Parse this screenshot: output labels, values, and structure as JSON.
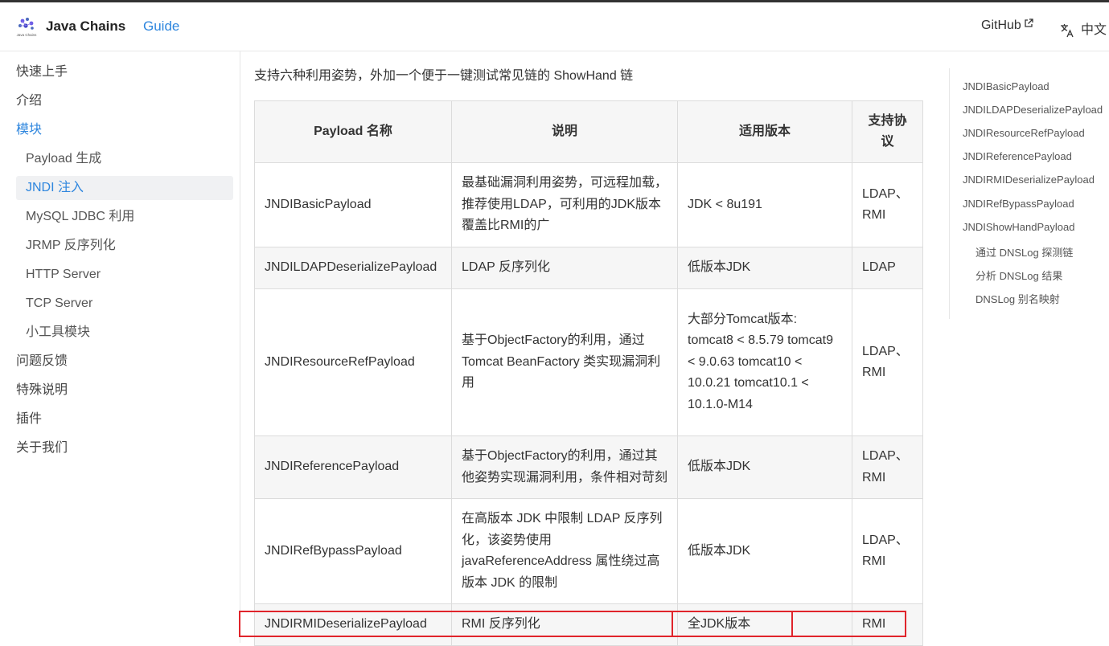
{
  "header": {
    "brand": "Java Chains",
    "nav_guide": "Guide",
    "github": "GitHub",
    "language": "中文",
    "logo_caption": "Java Chains"
  },
  "sidebar": {
    "items": [
      {
        "label": "快速上手"
      },
      {
        "label": "介绍"
      },
      {
        "label": "模块"
      },
      {
        "label": "Payload 生成"
      },
      {
        "label": "JNDI 注入"
      },
      {
        "label": "MySQL JDBC 利用"
      },
      {
        "label": "JRMP 反序列化"
      },
      {
        "label": "HTTP Server"
      },
      {
        "label": "TCP Server"
      },
      {
        "label": "小工具模块"
      },
      {
        "label": "问题反馈"
      },
      {
        "label": "特殊说明"
      },
      {
        "label": "插件"
      },
      {
        "label": "关于我们"
      }
    ]
  },
  "content": {
    "intro": "支持六种利用姿势，外加一个便于一键测试常见链的 ShowHand 链",
    "table": {
      "headers": [
        "Payload 名称",
        "说明",
        "适用版本",
        "支持协议"
      ],
      "rows": [
        {
          "name": "JNDIBasicPayload",
          "desc": "最基础漏洞利用姿势，可远程加载，推荐使用LDAP，可利用的JDK版本覆盖比RMI的广",
          "version": "JDK < 8u191",
          "protocol": "LDAP、RMI"
        },
        {
          "name": "JNDILDAPDeserializePayload",
          "desc": "LDAP 反序列化",
          "version": "低版本JDK",
          "protocol": "LDAP"
        },
        {
          "name": "JNDIResourceRefPayload",
          "desc": "基于ObjectFactory的利用，通过 Tomcat BeanFactory 类实现漏洞利用",
          "version": "大部分Tomcat版本: tomcat8 < 8.5.79 tomcat9 < 9.0.63 tomcat10 < 10.0.21 tomcat10.1 < 10.1.0-M14",
          "protocol": "LDAP、RMI"
        },
        {
          "name": "JNDIReferencePayload",
          "desc": "基于ObjectFactory的利用，通过其他姿势实现漏洞利用，条件相对苛刻",
          "version": "低版本JDK",
          "protocol": "LDAP、RMI"
        },
        {
          "name": "JNDIRefBypassPayload",
          "desc": "在高版本 JDK 中限制 LDAP 反序列化，该姿势使用 javaReferenceAddress 属性绕过高版本 JDK 的限制",
          "version": "低版本JDK",
          "protocol": "LDAP、RMI"
        },
        {
          "name": "JNDIRMIDeserializePayload",
          "desc": "RMI 反序列化",
          "version": "全JDK版本",
          "protocol": "RMI"
        }
      ]
    }
  },
  "toc": {
    "items": [
      {
        "label": "JNDIBasicPayload"
      },
      {
        "label": "JNDILDAPDeserializePayload"
      },
      {
        "label": "JNDIResourceRefPayload"
      },
      {
        "label": "JNDIReferencePayload"
      },
      {
        "label": "JNDIRMIDeserializePayload"
      },
      {
        "label": "JNDIRefBypassPayload"
      },
      {
        "label": "JNDIShowHandPayload"
      },
      {
        "label": "通过 DNSLog 探测链"
      },
      {
        "label": "分析 DNSLog 结果"
      },
      {
        "label": "DNSLog 别名映射"
      }
    ]
  },
  "colors": {
    "accent": "#2e86de",
    "highlight_box": "#e0242b"
  }
}
